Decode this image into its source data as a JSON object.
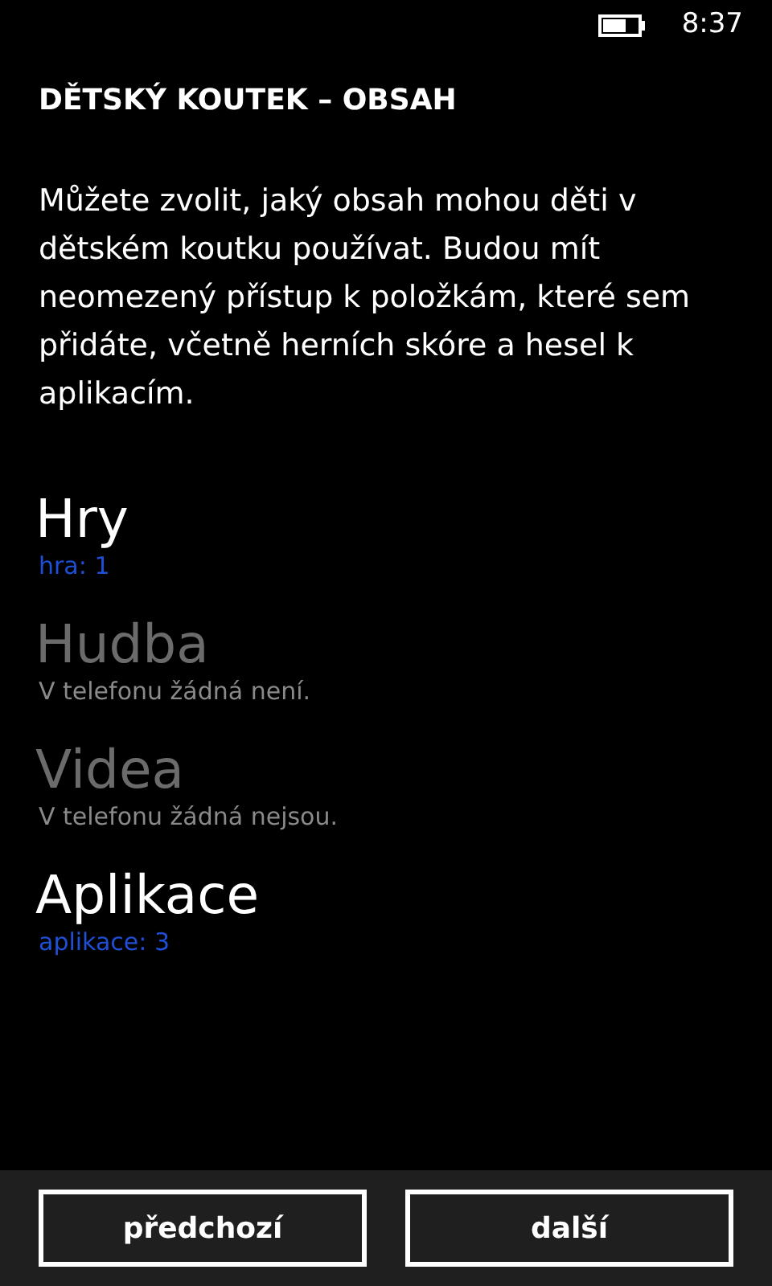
{
  "status_bar": {
    "time": "8:37"
  },
  "title": "DĚTSKÝ KOUTEK – OBSAH",
  "description": "Můžete zvolit, jaký obsah mohou děti v dětském koutku používat. Budou mít neomezený přístup k položkám, které sem přidáte, včetně herních skóre a hesel k aplikacím.",
  "items": [
    {
      "label": "Hry",
      "detail": "hra: 1",
      "disabled": false
    },
    {
      "label": "Hudba",
      "detail": "V telefonu žádná není.",
      "disabled": true
    },
    {
      "label": "Videa",
      "detail": "V telefonu žádná nejsou.",
      "disabled": true
    },
    {
      "label": "Aplikace",
      "detail": "aplikace: 3",
      "disabled": false
    }
  ],
  "buttons": [
    "předchozí",
    "další"
  ]
}
